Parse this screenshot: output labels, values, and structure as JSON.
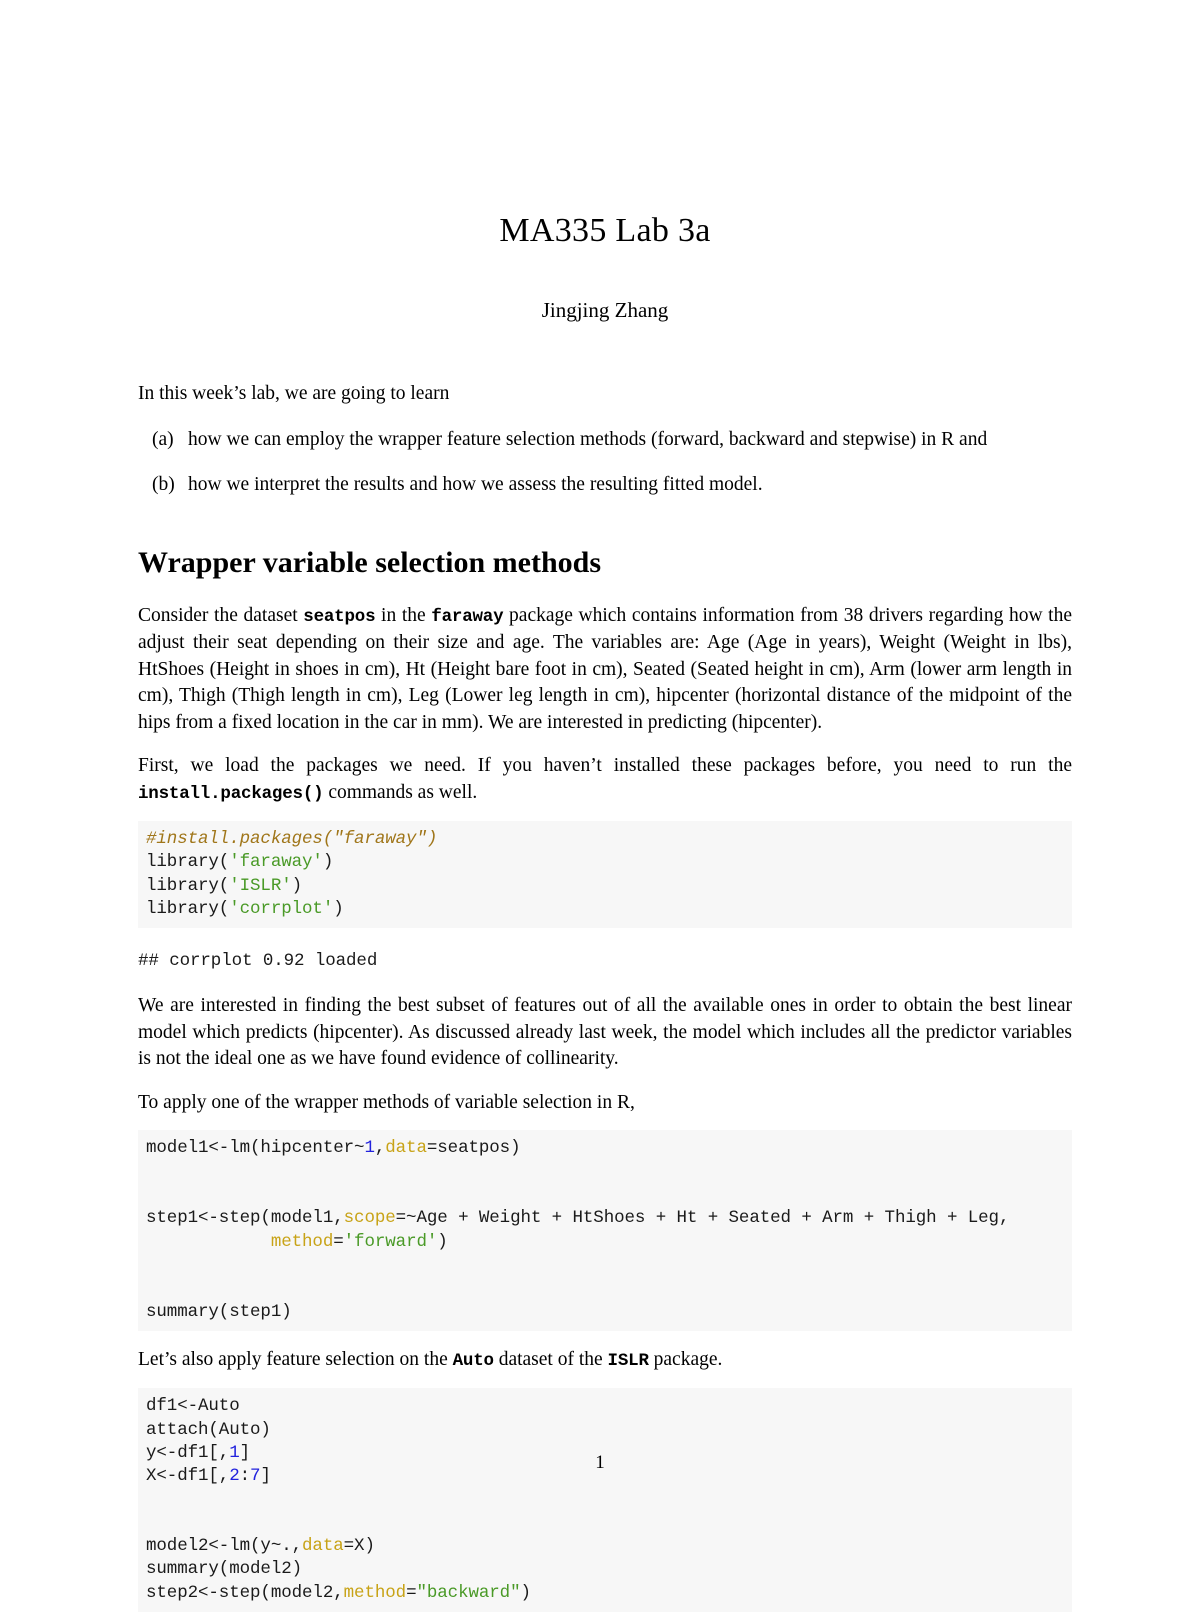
{
  "document": {
    "title": "MA335 Lab 3a",
    "author": "Jingjing Zhang",
    "page_number": "1"
  },
  "intro": {
    "lead": "In this week’s lab, we are going to learn",
    "items": [
      {
        "marker": "(a)",
        "text": "how we can employ the wrapper feature selection methods (forward, backward and stepwise) in R and"
      },
      {
        "marker": "(b)",
        "text": "how we interpret the results and how we assess the resulting fitted model."
      }
    ]
  },
  "section": {
    "heading": "Wrapper variable selection methods",
    "para1_a": "Consider the dataset ",
    "para1_code1": "seatpos",
    "para1_b": " in the ",
    "para1_code2": "faraway",
    "para1_c": " package which contains information from 38 drivers regarding how the adjust their seat depending on their size and age. The variables are: Age (Age in years), Weight (Weight in lbs), HtShoes (Height in shoes in cm), Ht (Height bare foot in cm), Seated (Seated height in cm), Arm (lower arm length in cm), Thigh (Thigh length in cm), Leg (Lower leg length in cm), hipcenter (horizontal distance of the midpoint of the hips from a fixed location in the car in mm). We are interested in predicting (hipcenter).",
    "para2_a": "First, we load the packages we need. If you haven’t installed these packages before, you need to run the ",
    "para2_code": "install.packages()",
    "para2_b": " commands as well.",
    "para3": "We are interested in finding the best subset of features out of all the available ones in order to obtain the best linear model which predicts (hipcenter). As discussed already last week, the model which includes all the predictor variables is not the ideal one as we have found evidence of collinearity.",
    "para4": "To apply one of the wrapper methods of variable selection in R,",
    "para5_a": "Let’s also apply feature selection on the ",
    "para5_code1": "Auto",
    "para5_b": " dataset of the ",
    "para5_code2": "ISLR",
    "para5_c": " package."
  },
  "code_blocks": {
    "block1": {
      "lines": [
        [
          {
            "t": "#install.packages(\"faraway\")",
            "c": "tok-comment"
          }
        ],
        [
          {
            "t": "library(",
            "c": ""
          },
          {
            "t": "'faraway'",
            "c": "tok-string"
          },
          {
            "t": ")",
            "c": ""
          }
        ],
        [
          {
            "t": "library(",
            "c": ""
          },
          {
            "t": "'ISLR'",
            "c": "tok-string"
          },
          {
            "t": ")",
            "c": ""
          }
        ],
        [
          {
            "t": "library(",
            "c": ""
          },
          {
            "t": "'corrplot'",
            "c": "tok-string"
          },
          {
            "t": ")",
            "c": ""
          }
        ]
      ]
    },
    "output1": "## corrplot 0.92 loaded",
    "block2": {
      "lines": [
        [
          {
            "t": "model1<-lm(hipcenter~",
            "c": ""
          },
          {
            "t": "1",
            "c": "tok-num"
          },
          {
            "t": ",",
            "c": ""
          },
          {
            "t": "data",
            "c": "tok-arg"
          },
          {
            "t": "=seatpos)",
            "c": ""
          }
        ],
        [
          {
            "t": "",
            "c": ""
          }
        ],
        [
          {
            "t": "",
            "c": ""
          }
        ],
        [
          {
            "t": "step1<-step(model1,",
            "c": ""
          },
          {
            "t": "scope",
            "c": "tok-arg"
          },
          {
            "t": "=~Age + Weight + HtShoes + Ht + Seated + Arm + Thigh + Leg,",
            "c": ""
          }
        ],
        [
          {
            "t": "            ",
            "c": ""
          },
          {
            "t": "method",
            "c": "tok-arg"
          },
          {
            "t": "=",
            "c": ""
          },
          {
            "t": "'forward'",
            "c": "tok-string"
          },
          {
            "t": ")",
            "c": ""
          }
        ],
        [
          {
            "t": "",
            "c": ""
          }
        ],
        [
          {
            "t": "",
            "c": ""
          }
        ],
        [
          {
            "t": "summary(step1)",
            "c": ""
          }
        ]
      ]
    },
    "block3": {
      "lines": [
        [
          {
            "t": "df1<-Auto",
            "c": ""
          }
        ],
        [
          {
            "t": "attach(Auto)",
            "c": ""
          }
        ],
        [
          {
            "t": "y<-df1[,",
            "c": ""
          },
          {
            "t": "1",
            "c": "tok-num"
          },
          {
            "t": "]",
            "c": ""
          }
        ],
        [
          {
            "t": "X<-df1[,",
            "c": ""
          },
          {
            "t": "2",
            "c": "tok-num"
          },
          {
            "t": ":",
            "c": ""
          },
          {
            "t": "7",
            "c": "tok-num"
          },
          {
            "t": "]",
            "c": ""
          }
        ],
        [
          {
            "t": "",
            "c": ""
          }
        ],
        [
          {
            "t": "",
            "c": ""
          }
        ],
        [
          {
            "t": "model2<-lm(y~.,",
            "c": ""
          },
          {
            "t": "data",
            "c": "tok-arg"
          },
          {
            "t": "=X)",
            "c": ""
          }
        ],
        [
          {
            "t": "summary(model2)",
            "c": ""
          }
        ],
        [
          {
            "t": "step2<-step(model2,",
            "c": ""
          },
          {
            "t": "method",
            "c": "tok-arg"
          },
          {
            "t": "=",
            "c": ""
          },
          {
            "t": "\"backward\"",
            "c": "tok-string"
          },
          {
            "t": ")",
            "c": ""
          }
        ]
      ]
    }
  }
}
